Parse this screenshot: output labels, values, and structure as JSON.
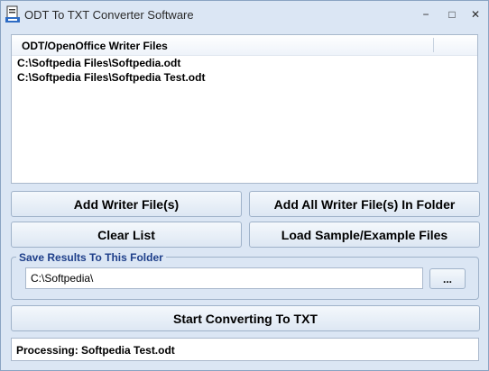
{
  "window": {
    "title": "ODT To TXT Converter Software",
    "minimize_label": "−",
    "maximize_label": "□",
    "close_label": "✕"
  },
  "file_list": {
    "header": "ODT/OpenOffice Writer Files",
    "items": [
      "C:\\Softpedia Files\\Softpedia.odt",
      "C:\\Softpedia Files\\Softpedia Test.odt"
    ]
  },
  "buttons": {
    "add_files": "Add Writer File(s)",
    "add_folder": "Add All Writer File(s) In Folder",
    "clear_list": "Clear List",
    "load_sample": "Load Sample/Example Files",
    "browse": "...",
    "start": "Start Converting To TXT"
  },
  "save_folder": {
    "label": "Save Results To This Folder",
    "value": "C:\\Softpedia\\"
  },
  "status": {
    "text": "Processing: Softpedia Test.odt"
  }
}
